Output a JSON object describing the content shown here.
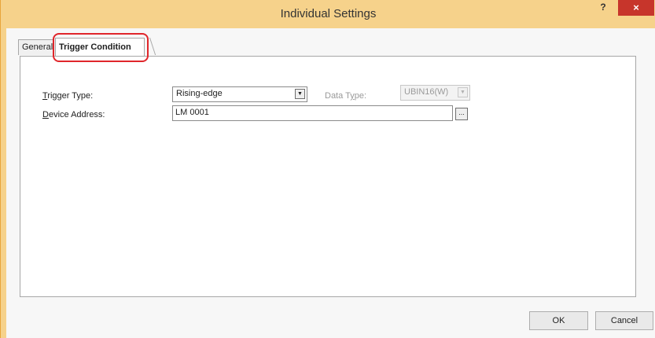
{
  "window": {
    "title": "Individual Settings",
    "help_label": "?",
    "close_label": "×"
  },
  "tabs": [
    {
      "label": "General"
    },
    {
      "label": "Trigger Condition",
      "selected": true
    }
  ],
  "form": {
    "trigger_type": {
      "label_prefix": "",
      "label_mnemonic": "T",
      "label_rest": "rigger Type:",
      "value": "Rising-edge",
      "arrow": "▼"
    },
    "data_type": {
      "label_prefix": "Data T",
      "label_mnemonic": "y",
      "label_rest": "pe:",
      "value": "UBIN16(W)",
      "arrow": "▼",
      "enabled": false
    },
    "device_address": {
      "label_prefix": "",
      "label_mnemonic": "D",
      "label_rest": "evice Address:",
      "value": "LM 0001",
      "browse_label": "..."
    }
  },
  "buttons": {
    "ok_label": "OK",
    "cancel_label": "Cancel"
  },
  "colors": {
    "title_bar": "#f6d28b",
    "close_button": "#c7352b",
    "highlight": "#e0262b"
  }
}
